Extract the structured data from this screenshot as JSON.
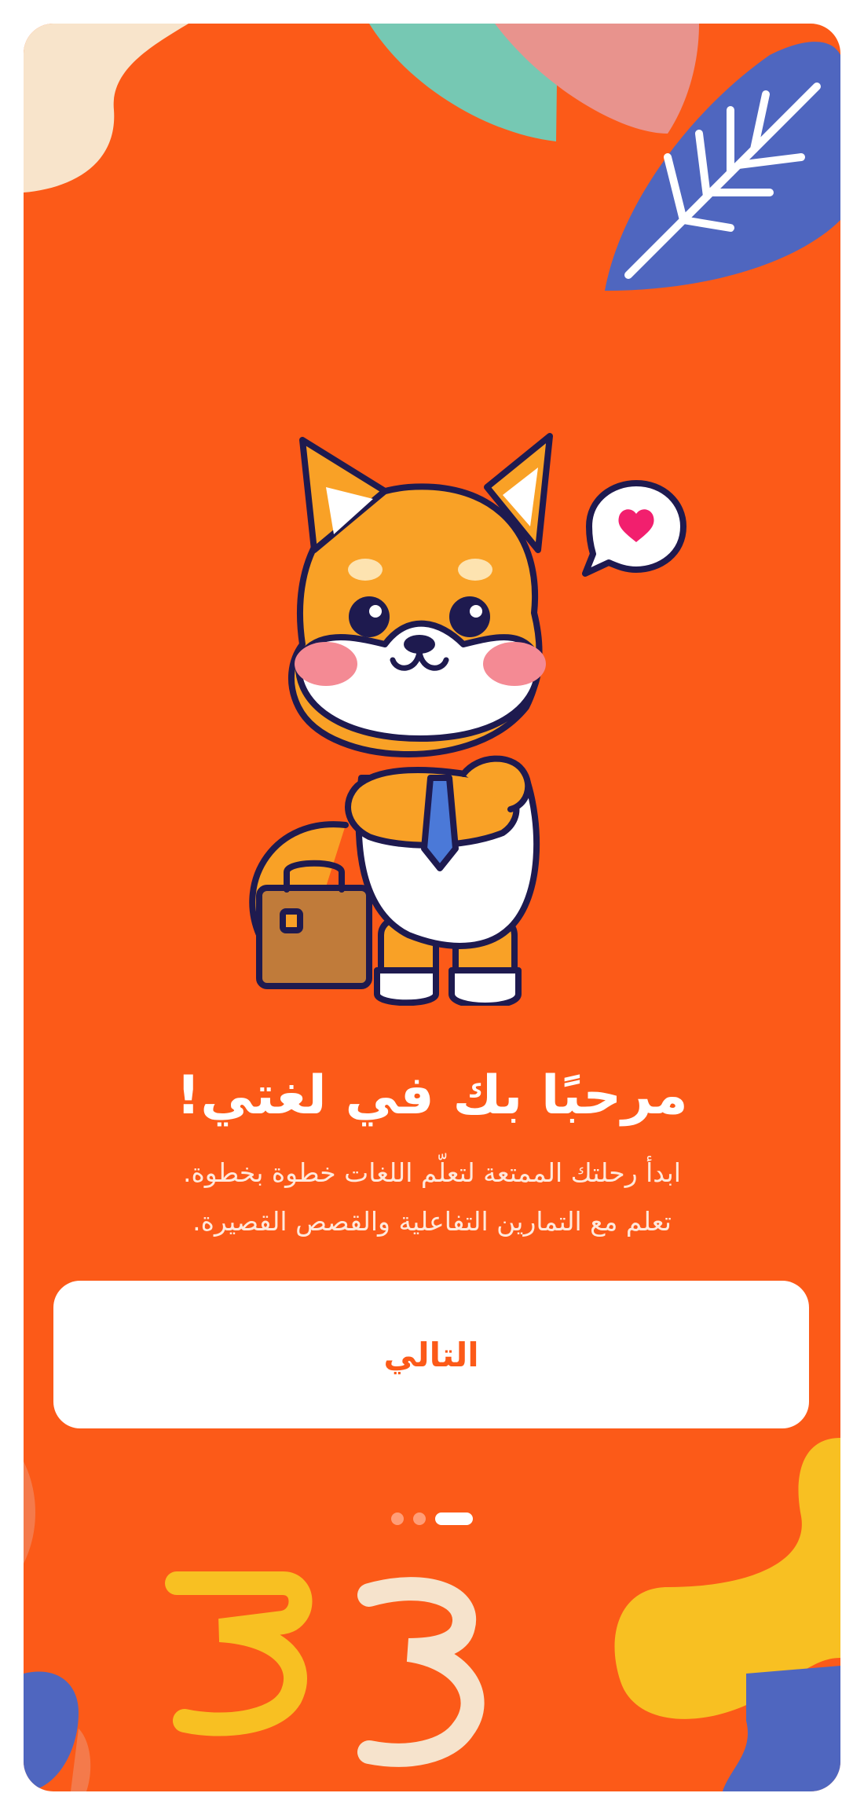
{
  "onboarding": {
    "title": "مرحبًا بك في لغتي!",
    "subtitle_line1": "ابدأ رحلتك الممتعة لتعلّم اللغات خطوة بخطوة.",
    "subtitle_line2": "تعلم مع التمارين التفاعلية والقصص القصيرة.",
    "next_label": "التالي",
    "pagination": {
      "current": 1,
      "total": 3
    }
  },
  "colors": {
    "background": "#FC5A18",
    "button_background": "#FFFFFF",
    "button_text": "#FC5A18",
    "dot_active": "#FFFFFF",
    "dot_inactive": "#FF9D77"
  },
  "illustration": "shiba-inu-businessman-mascot"
}
